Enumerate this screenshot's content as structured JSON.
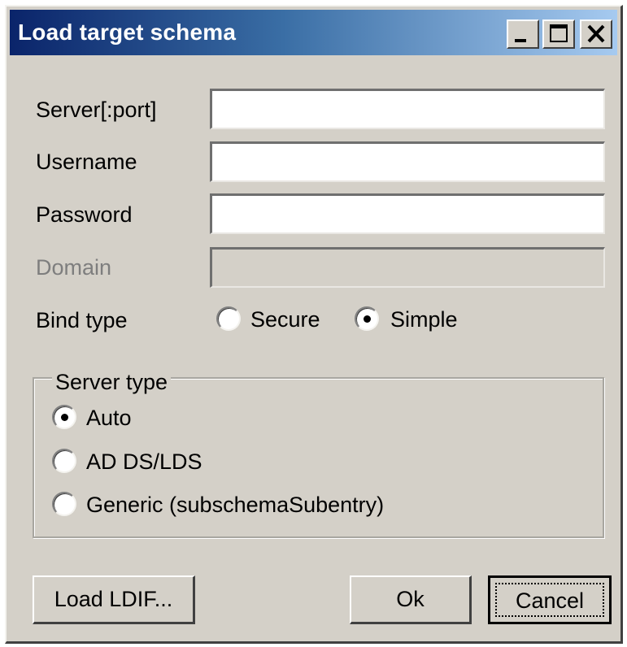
{
  "window": {
    "title": "Load target schema",
    "controls": {
      "minimize": "_",
      "maximize": "□",
      "close": "X"
    }
  },
  "form": {
    "server_label": "Server[:port]",
    "server_value": "",
    "username_label": "Username",
    "username_value": "",
    "password_label": "Password",
    "password_value": "",
    "domain_label": "Domain",
    "domain_value": "",
    "bind_type_label": "Bind type",
    "bind_options": [
      {
        "label": "Secure",
        "selected": false
      },
      {
        "label": "Simple",
        "selected": true
      }
    ]
  },
  "server_type": {
    "legend": "Server type",
    "options": [
      {
        "label": "Auto",
        "selected": true
      },
      {
        "label": "AD DS/LDS",
        "selected": false
      },
      {
        "label": "Generic (subschemaSubentry)",
        "selected": false
      }
    ]
  },
  "buttons": {
    "load_ldif": "Load LDIF...",
    "ok": "Ok",
    "cancel": "Cancel"
  },
  "colors": {
    "dialog_face": "#d4d0c8",
    "title_gradient_start": "#0a246a",
    "title_gradient_end": "#a6caf0",
    "disabled_text": "#7e7e7e"
  }
}
